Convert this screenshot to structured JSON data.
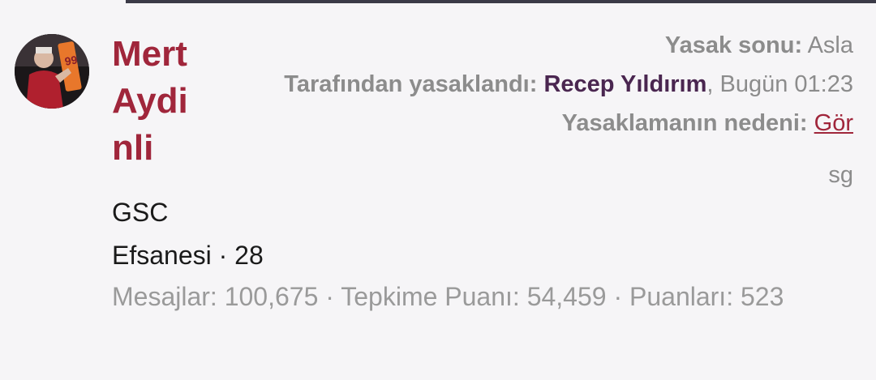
{
  "user": {
    "name": "Mert Aydinli",
    "title": "GSC",
    "rank_line": "Efsanesi · 28",
    "avatar_icon": "user-avatar-photo"
  },
  "stats": {
    "text": "Mesajlar: 100,675 · Tepkime Puanı: 54,459 · Puanları: 523"
  },
  "ban": {
    "end_label": "Yasak sonu:",
    "end_value": "Asla",
    "by_label": "Tarafından yasaklandı:",
    "by_user": "Recep Yıldırım",
    "by_time": ", Bugün 01:23",
    "reason_label": "Yasaklamanın nedeni:",
    "reason_link": "Gör",
    "note": "sg"
  },
  "colors": {
    "username": "#a0263b",
    "staff_username": "#4a2650",
    "muted": "#8c8c8c",
    "background": "#f6f5f7"
  }
}
